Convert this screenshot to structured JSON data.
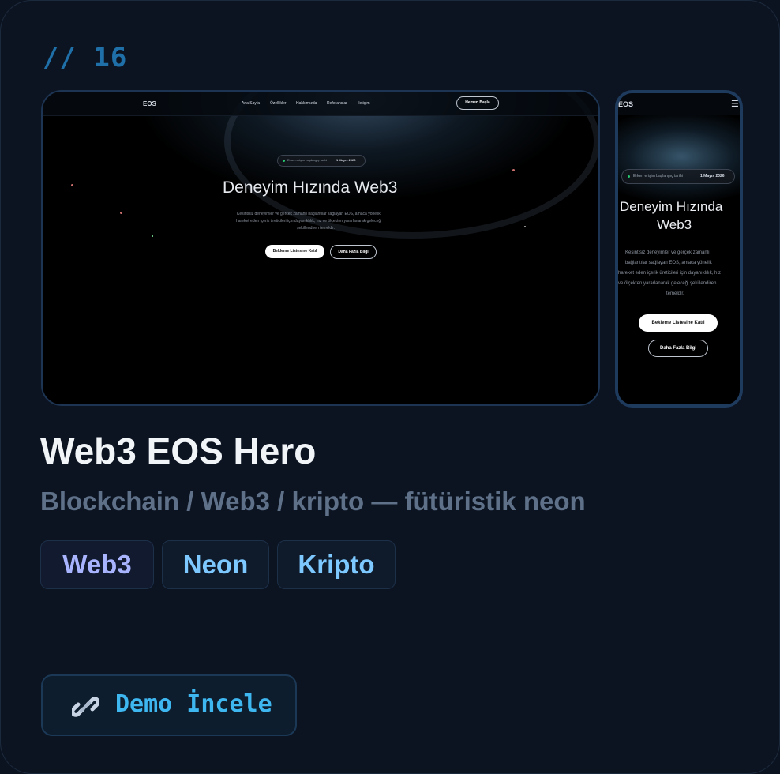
{
  "card": {
    "number": "// 16",
    "title": "Web3 EOS Hero",
    "subtitle": "Blockchain / Web3 / kripto — fütüristik neon",
    "tags": [
      "Web3",
      "Neon",
      "Kripto"
    ],
    "demo_label": "Demo İncele"
  },
  "desktop_preview": {
    "logo": "EOS",
    "nav": [
      "Ana Sayfa",
      "Özellikler",
      "Hakkımızda",
      "Referanslar",
      "İletişim"
    ],
    "cta": "Hemen Başla",
    "badge_text": "Erken erişim başlangıç tarihi",
    "badge_date": "1 Mayıs 2026",
    "headline": "Deneyim Hızında Web3",
    "body_lines": [
      "Kesintisiz deneyimler ve gerçek zamanlı bağlantılar sağlayan EOS, amaca yönelik",
      "hareket eden içerik üreticileri için dayanıklılık, hız ve ölçekten yararlanarak geleceği",
      "şekillendiren temeldir."
    ],
    "btn_primary": "Bekleme Listesine Katıl",
    "btn_secondary": "Daha Fazla Bilgi"
  },
  "mobile_preview": {
    "logo": "EOS",
    "menu_icon": "hamburger-icon",
    "badge_text": "Erken erişim başlangıç tarihi",
    "badge_date": "1 Mayıs 2026",
    "headline_line1": "Deneyim Hızında",
    "headline_line2": "Web3",
    "body_lines": [
      "Kesintisiz deneyimler ve gerçek zamanlı",
      "bağlantılar sağlayan EOS, amaca yönelik",
      "hareket eden içerik üreticileri için dayanıklılık, hız",
      "ve ölçekten yararlanarak geleceği şekillendiren",
      "temeldir."
    ],
    "btn_primary": "Bekleme Listesine Katıl",
    "btn_secondary": "Daha Fazla Bilgi"
  },
  "colors": {
    "card_bg": "#0c1422",
    "accent": "#3eb7f0",
    "tag_web3": "#a9b4ff",
    "tag_other": "#7cc8ff"
  }
}
